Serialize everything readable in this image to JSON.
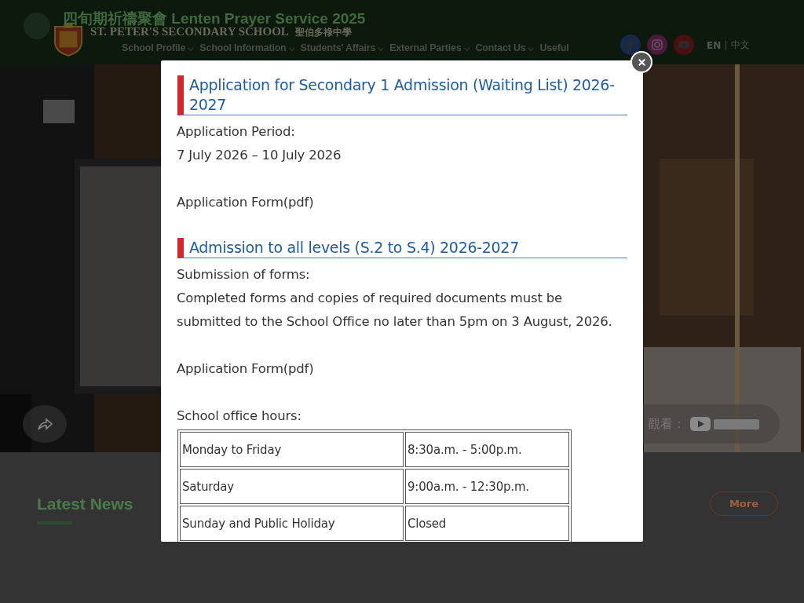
{
  "video": {
    "title": "四旬期祈禱聚會 Lenten Prayer Service 2025",
    "watch_label": "觀看："
  },
  "header": {
    "school_name_en": "ST. PETER'S SECONDARY SCHOOL",
    "school_name_zh": "聖伯多祿中學",
    "nav": [
      {
        "label": "School Profile",
        "dropdown": true
      },
      {
        "label": "School Information",
        "dropdown": true
      },
      {
        "label": "Students' Affairs",
        "dropdown": true
      },
      {
        "label": "External Parties",
        "dropdown": true
      },
      {
        "label": "Contact Us",
        "dropdown": true
      },
      {
        "label": "Useful",
        "dropdown": false
      }
    ],
    "socials": [
      {
        "kind": "facebook"
      },
      {
        "kind": "instagram"
      },
      {
        "kind": "youtube"
      }
    ],
    "languages": [
      "EN",
      "中文"
    ]
  },
  "latest_news": {
    "title": "Latest News",
    "more": "More"
  },
  "modal": {
    "blocks": [
      {
        "kind": "heading",
        "text": "Application for Secondary 1 Admission (Waiting List) 2026-2027"
      },
      {
        "kind": "line",
        "text": "Application Period:"
      },
      {
        "kind": "line",
        "text": "7 July 2026 – 10 July 2026"
      },
      {
        "kind": "gap"
      },
      {
        "kind": "line",
        "text": "Application Form(pdf)"
      },
      {
        "kind": "gap"
      },
      {
        "kind": "heading",
        "text": "Admission to all levels (S.2 to S.4) 2026-2027"
      },
      {
        "kind": "line",
        "text": "Submission of forms:"
      },
      {
        "kind": "line",
        "text": "Completed forms and copies of required documents must be submitted to the School Office no later than 5pm on 3 August, 2026."
      },
      {
        "kind": "gap"
      },
      {
        "kind": "line",
        "text": "Application Form(pdf)"
      },
      {
        "kind": "gap"
      },
      {
        "kind": "line",
        "text": "School office hours:"
      },
      {
        "kind": "table",
        "rows": [
          [
            "Monday to Friday",
            "8:30a.m. - 5:00p.m."
          ],
          [
            "Saturday",
            "9:00a.m. - 12:30p.m."
          ],
          [
            "Sunday and Public Holiday",
            "Closed"
          ]
        ]
      }
    ]
  }
}
